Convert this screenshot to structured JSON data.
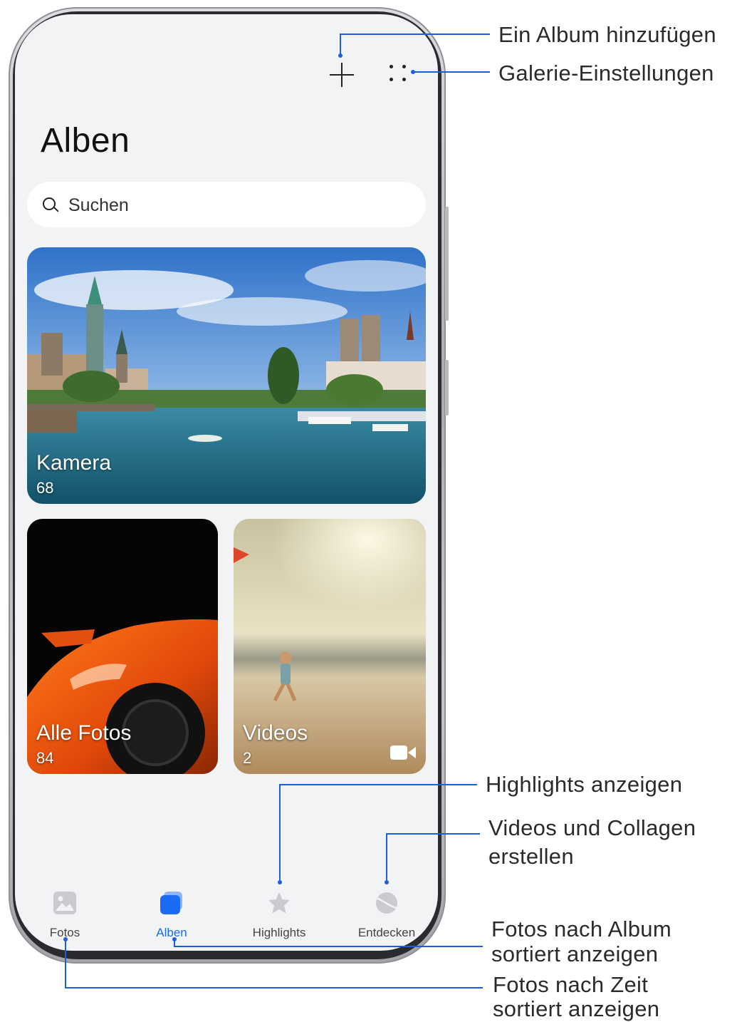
{
  "header": {
    "title": "Alben"
  },
  "search": {
    "placeholder": "Suchen"
  },
  "albums": [
    {
      "name": "Kamera",
      "count": "68"
    },
    {
      "name": "Alle Fotos",
      "count": "84"
    },
    {
      "name": "Videos",
      "count": "2",
      "icon": "video-icon"
    }
  ],
  "nav": {
    "items": [
      {
        "label": "Fotos",
        "icon": "photo-icon",
        "active": false
      },
      {
        "label": "Alben",
        "icon": "albums-icon",
        "active": true
      },
      {
        "label": "Highlights",
        "icon": "star-icon",
        "active": false
      },
      {
        "label": "Entdecken",
        "icon": "discover-icon",
        "active": false
      }
    ]
  },
  "callouts": {
    "add_album": "Ein Album hinzufügen",
    "settings": "Galerie-Einstellungen",
    "highlights": "Highlights anzeigen",
    "create_line1": "Videos und Collagen",
    "create_line2": "erstellen",
    "by_album_line1": "Fotos nach Album",
    "by_album_line2": "sortiert anzeigen",
    "by_time_line1": "Fotos nach Zeit",
    "by_time_line2": "sortiert anzeigen"
  },
  "colors": {
    "accent": "#1a6cf5",
    "callout_line": "#1a5fe0",
    "screen_bg": "#f1f3f5"
  }
}
